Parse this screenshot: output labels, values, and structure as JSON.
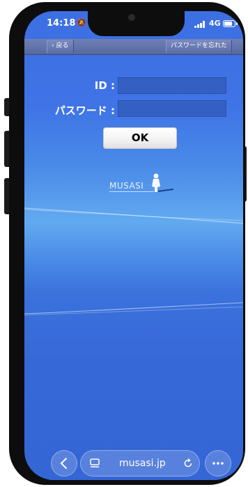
{
  "status_bar": {
    "time": "14:18",
    "network": "4G"
  },
  "nav": {
    "back_label": "戻る",
    "forgot_label": "パスワードを忘れた"
  },
  "form": {
    "id_label": "ID :",
    "password_label": "パスワード :",
    "id_value": "",
    "password_value": ""
  },
  "ok_label": "OK",
  "logo_text": "MUSASI",
  "browser": {
    "url": "musasi.jp"
  },
  "colors": {
    "background": "#3c6fe2",
    "navbar": "#5f72aa",
    "field": "#3460c4"
  }
}
